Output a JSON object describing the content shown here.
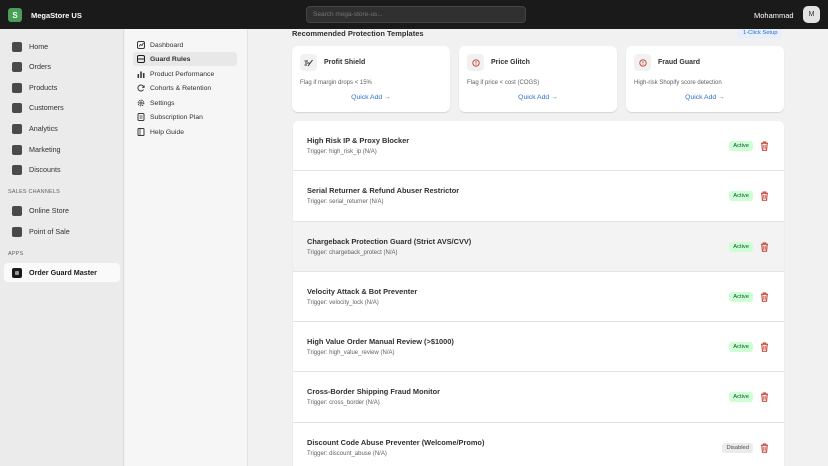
{
  "topbar": {
    "logo_letter": "S",
    "store_name": "MegaStore US",
    "search_placeholder": "Search mega-store-us...",
    "user_name": "Mohammad",
    "avatar_initial": "M"
  },
  "sidebar": {
    "items": [
      {
        "label": "Home",
        "icon": "home-icon"
      },
      {
        "label": "Orders",
        "icon": "orders-icon"
      },
      {
        "label": "Products",
        "icon": "products-icon"
      },
      {
        "label": "Customers",
        "icon": "customers-icon"
      },
      {
        "label": "Analytics",
        "icon": "analytics-icon"
      },
      {
        "label": "Marketing",
        "icon": "marketing-icon"
      },
      {
        "label": "Discounts",
        "icon": "discounts-icon"
      }
    ],
    "sales_channels_heading": "SALES CHANNELS",
    "sales_channels": [
      {
        "label": "Online Store",
        "icon": "online-store-icon"
      },
      {
        "label": "Point of Sale",
        "icon": "point-of-sale-icon"
      }
    ],
    "apps_heading": "APPS",
    "apps": [
      {
        "label": "Order Guard Master",
        "icon": "order-guard-app-icon",
        "active": true
      }
    ]
  },
  "subnav": {
    "items": [
      {
        "label": "Dashboard",
        "icon": "dashboard-icon"
      },
      {
        "label": "Guard Rules",
        "icon": "guard-rules-icon",
        "active": true
      },
      {
        "label": "Product Performance",
        "icon": "bar-chart-icon"
      },
      {
        "label": "Cohorts & Retention",
        "icon": "refresh-icon"
      },
      {
        "label": "Settings",
        "icon": "gear-icon"
      },
      {
        "label": "Subscription Plan",
        "icon": "plan-icon"
      },
      {
        "label": "Help Guide",
        "icon": "book-icon"
      }
    ]
  },
  "templates": {
    "title": "Recommended Protection Templates",
    "badge": "1-Click Setup",
    "cards": [
      {
        "title": "Profit Shield",
        "desc": "Flag if margin drops < 15%",
        "action": "Quick Add →",
        "icon": "shield-graph-icon"
      },
      {
        "title": "Price Glitch",
        "desc": "Flag if price < cost (COGS)",
        "action": "Quick Add →",
        "icon": "alert-circle-icon"
      },
      {
        "title": "Fraud Guard",
        "desc": "High-risk Shopify score detection",
        "action": "Quick Add →",
        "icon": "alert-circle-icon"
      }
    ]
  },
  "rules": [
    {
      "title": "High Risk IP & Proxy Blocker",
      "trigger": "Trigger: high_risk_ip (N/A)",
      "status": "Active"
    },
    {
      "title": "Serial Returner & Refund Abuser Restrictor",
      "trigger": "Trigger: serial_returner (N/A)",
      "status": "Active"
    },
    {
      "title": "Chargeback Protection Guard (Strict AVS/CVV)",
      "trigger": "Trigger: chargeback_protect (N/A)",
      "status": "Active"
    },
    {
      "title": "Velocity Attack & Bot Preventer",
      "trigger": "Trigger: velocity_lock (N/A)",
      "status": "Active"
    },
    {
      "title": "High Value Order Manual Review (>$1000)",
      "trigger": "Trigger: high_value_review (N/A)",
      "status": "Active"
    },
    {
      "title": "Cross-Border Shipping Fraud Monitor",
      "trigger": "Trigger: cross_border (N/A)",
      "status": "Active"
    },
    {
      "title": "Discount Code Abuse Preventer (Welcome/Promo)",
      "trigger": "Trigger: discount_abuse (N/A)",
      "status": "Disabled"
    }
  ],
  "colors": {
    "topbar": "#1a1a1a",
    "link": "#2c6ecb",
    "active_badge_bg": "#cdfed4",
    "trash": "#c0392b"
  }
}
